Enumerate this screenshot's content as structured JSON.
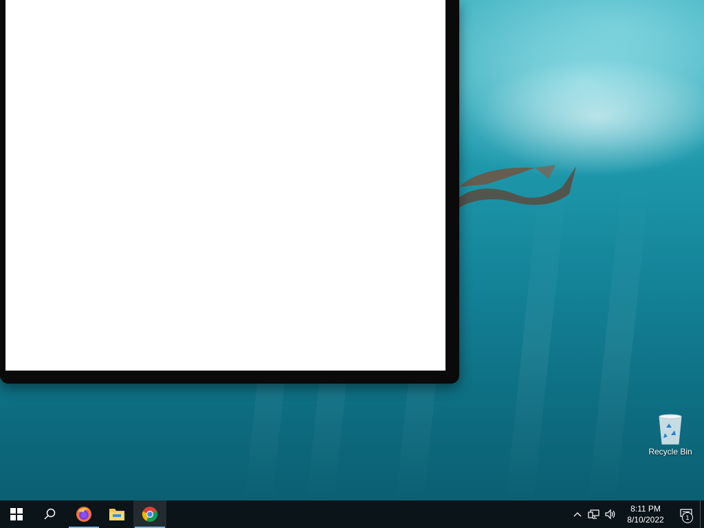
{
  "desktop": {
    "icons": [
      {
        "label": "Recycle Bin",
        "icon": "recycle-bin-icon"
      }
    ]
  },
  "window": {
    "content": ""
  },
  "taskbar": {
    "start_icon": "windows-logo-icon",
    "search_icon": "search-icon",
    "apps": [
      {
        "name": "Firefox",
        "icon": "firefox-icon",
        "running": true,
        "active": false
      },
      {
        "name": "File Explorer",
        "icon": "folder-icon",
        "running": false,
        "active": false
      },
      {
        "name": "Google Chrome",
        "icon": "chrome-icon",
        "running": true,
        "active": true
      }
    ],
    "tray": {
      "icons": [
        "chevron-up-icon",
        "network-icon",
        "volume-icon"
      ],
      "time": "8:11 PM",
      "date": "8/10/2022",
      "notification_count": "1"
    }
  },
  "colors": {
    "taskbar_bg": "#0a1419",
    "running_indicator": "#76b9ed"
  }
}
